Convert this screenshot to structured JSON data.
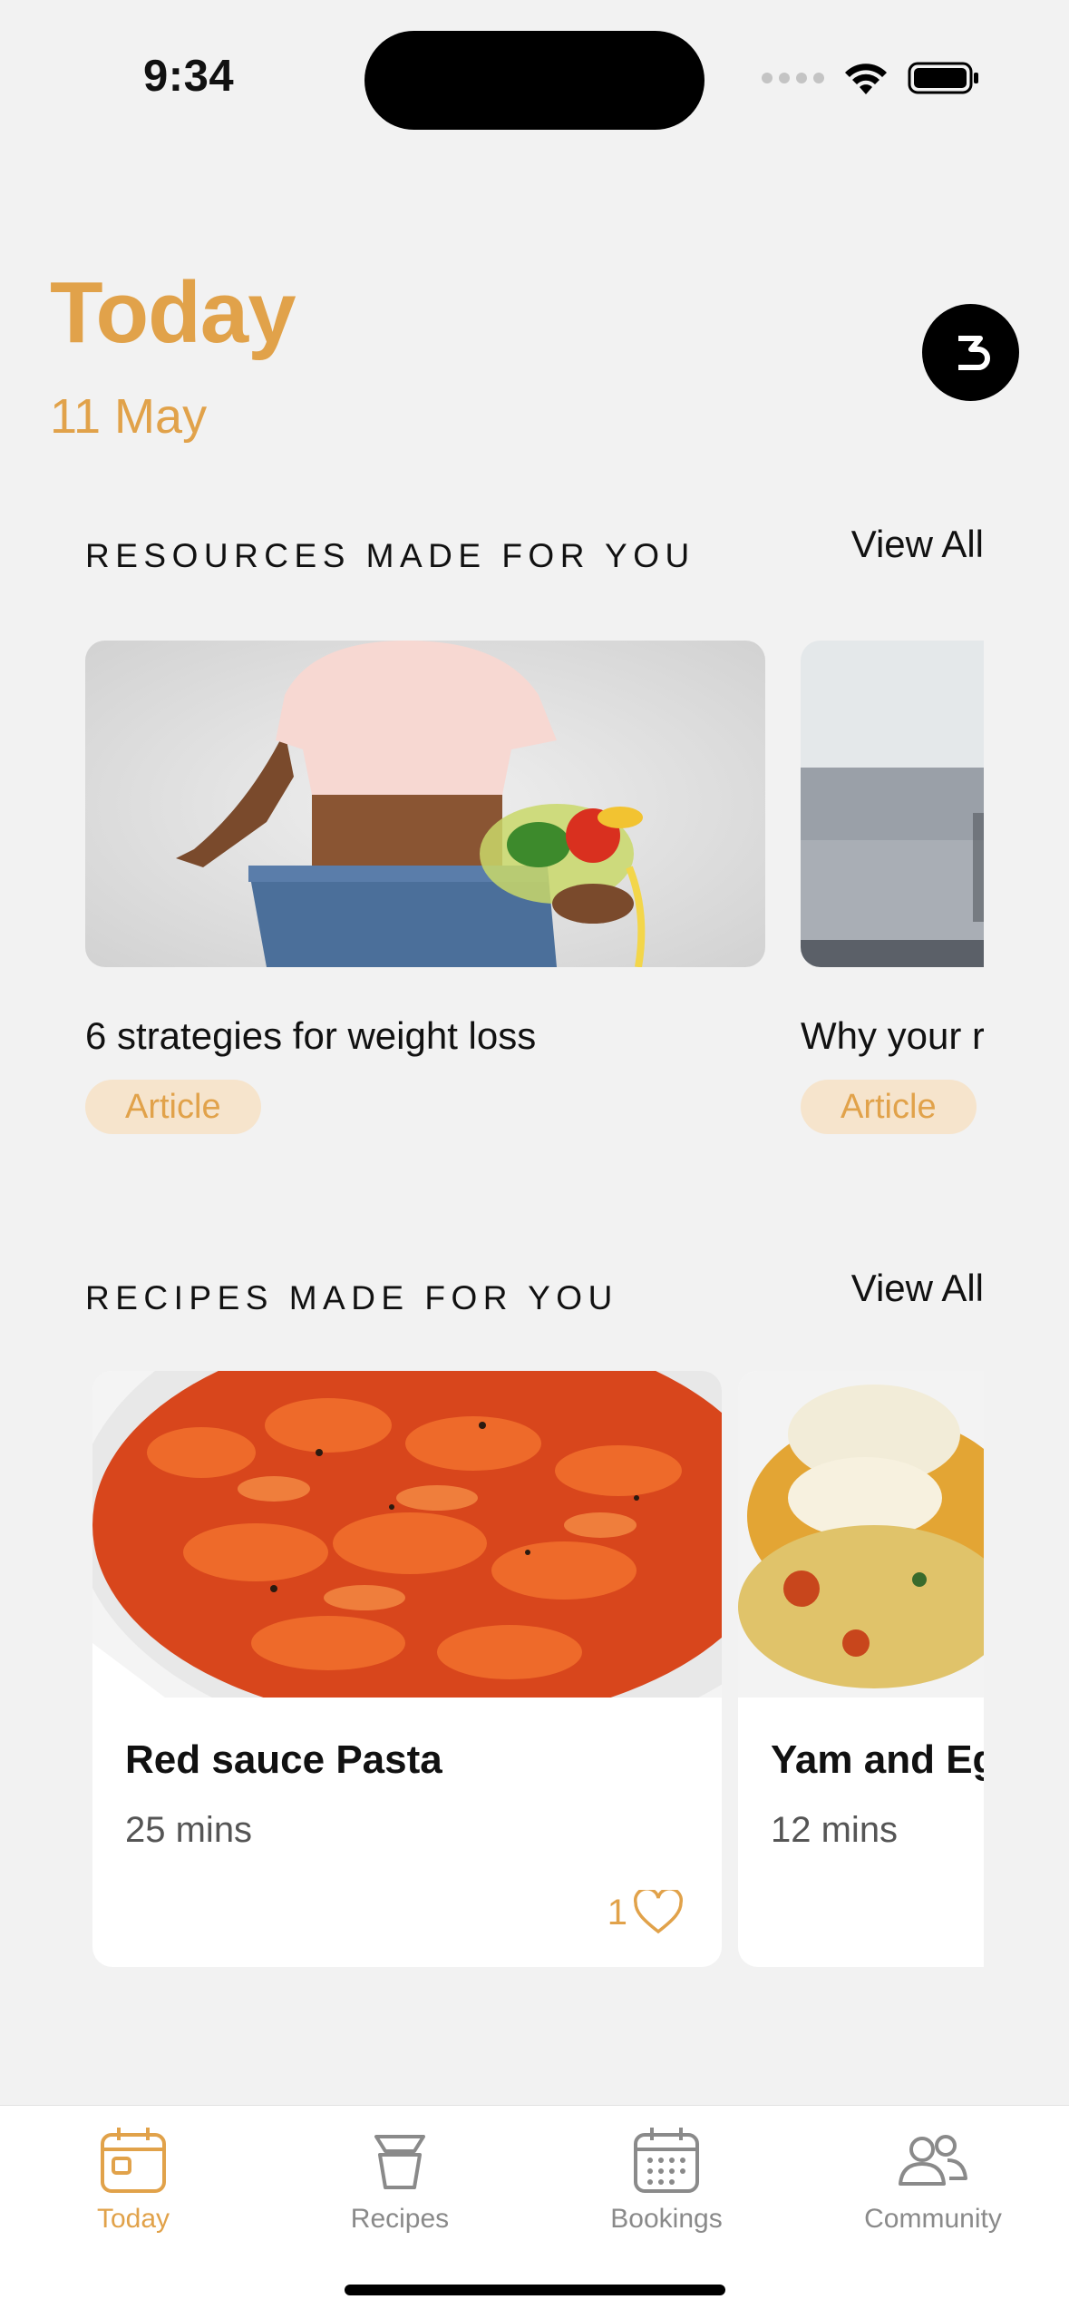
{
  "status_bar": {
    "time": "9:34"
  },
  "header": {
    "title": "Today",
    "date": "11 May",
    "avatar_letter": "3"
  },
  "resources": {
    "title": "RESOURCES MADE FOR YOU",
    "view_all": "View All",
    "items": [
      {
        "title": "6 strategies for weight loss",
        "tag": "Article"
      },
      {
        "title": "Why your r",
        "tag": "Article"
      }
    ]
  },
  "recipes": {
    "title": "RECIPES MADE FOR YOU",
    "view_all": "View All",
    "items": [
      {
        "name": "Red sauce Pasta",
        "time": "25 mins",
        "likes": "1"
      },
      {
        "name": "Yam and Eg",
        "time": "12 mins"
      }
    ]
  },
  "tabs": [
    {
      "label": "Today",
      "icon": "calendar-day-icon",
      "active": true
    },
    {
      "label": "Recipes",
      "icon": "cooking-pot-icon",
      "active": false
    },
    {
      "label": "Bookings",
      "icon": "calendar-grid-icon",
      "active": false
    },
    {
      "label": "Community",
      "icon": "people-icon",
      "active": false
    }
  ],
  "colors": {
    "accent": "#e1a24a",
    "badge_bg": "#f6e4cc",
    "background": "#f2f2f2"
  }
}
